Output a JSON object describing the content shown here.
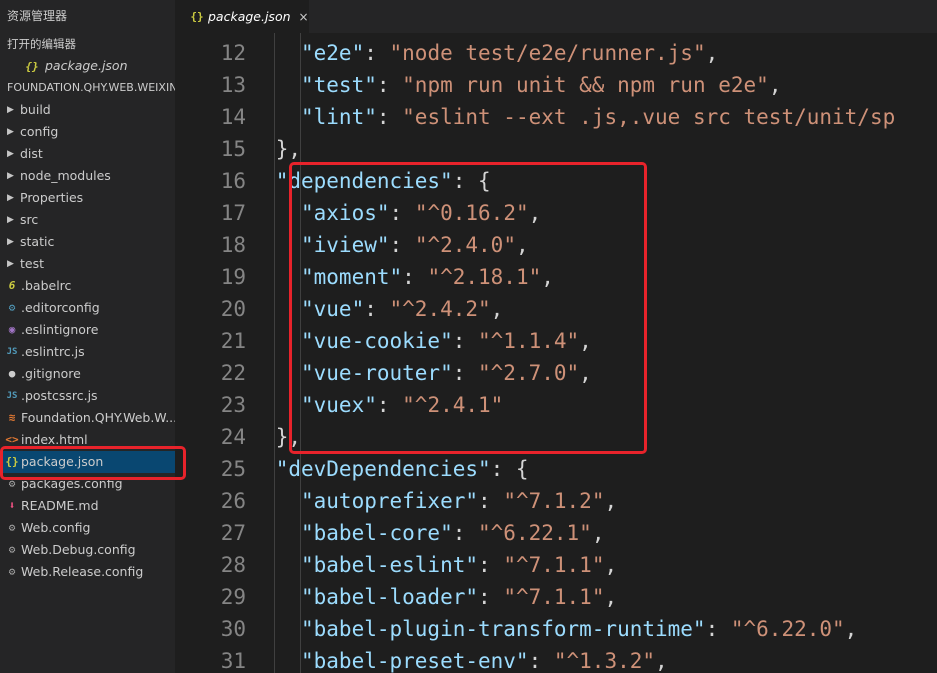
{
  "sidebar": {
    "title": "资源管理器",
    "open_editors_label": "打开的编辑器",
    "open_editors": [
      {
        "name": "package.json",
        "icon": "json-braces-icon"
      }
    ],
    "project_name": "FOUNDATION.QHY.WEB.WEIXIN...",
    "folders": [
      "build",
      "config",
      "dist",
      "node_modules",
      "Properties",
      "src",
      "static",
      "test"
    ],
    "files": [
      {
        "name": ".babelrc",
        "icon": "babel-icon",
        "glyph": "6"
      },
      {
        "name": ".editorconfig",
        "icon": "editorconfig-icon",
        "glyph": "⚙"
      },
      {
        "name": ".eslintignore",
        "icon": "eslint-icon",
        "glyph": "◉"
      },
      {
        "name": ".eslintrc.js",
        "icon": "js-file-icon",
        "glyph": "JS"
      },
      {
        "name": ".gitignore",
        "icon": "git-icon",
        "glyph": "●"
      },
      {
        "name": ".postcssrc.js",
        "icon": "js-file-icon",
        "glyph": "JS"
      },
      {
        "name": "Foundation.QHY.Web.W...",
        "icon": "rss-icon",
        "glyph": "≋"
      },
      {
        "name": "index.html",
        "icon": "html-icon",
        "glyph": "<>"
      },
      {
        "name": "package.json",
        "icon": "json-braces-icon",
        "glyph": "{}",
        "selected": true
      },
      {
        "name": "packages.config",
        "icon": "gear-icon",
        "glyph": "⚙"
      },
      {
        "name": "README.md",
        "icon": "readme-icon",
        "glyph": "⬇"
      },
      {
        "name": "Web.config",
        "icon": "gear-icon",
        "glyph": "⚙"
      },
      {
        "name": "Web.Debug.config",
        "icon": "gear-icon",
        "glyph": "⚙"
      },
      {
        "name": "Web.Release.config",
        "icon": "gear-icon",
        "glyph": "⚙"
      }
    ]
  },
  "tab": {
    "label": "package.json",
    "icon": "json-braces-icon",
    "close_glyph": "×"
  },
  "editor": {
    "lines": [
      {
        "n": "12",
        "indent": 2,
        "tokens": [
          [
            "k",
            "\"e2e\""
          ],
          [
            "p",
            ": "
          ],
          [
            "s",
            "\"node test/e2e/runner.js\""
          ],
          [
            "p",
            ","
          ]
        ]
      },
      {
        "n": "13",
        "indent": 2,
        "tokens": [
          [
            "k",
            "\"test\""
          ],
          [
            "p",
            ": "
          ],
          [
            "s",
            "\"npm run unit && npm run e2e\""
          ],
          [
            "p",
            ","
          ]
        ]
      },
      {
        "n": "14",
        "indent": 2,
        "tokens": [
          [
            "k",
            "\"lint\""
          ],
          [
            "p",
            ": "
          ],
          [
            "s",
            "\"eslint --ext .js,.vue src test/unit/sp"
          ]
        ]
      },
      {
        "n": "15",
        "indent": 1,
        "tokens": [
          [
            "p",
            "},"
          ]
        ]
      },
      {
        "n": "16",
        "indent": 1,
        "tokens": [
          [
            "k",
            "\"dependencies\""
          ],
          [
            "p",
            ": {"
          ]
        ]
      },
      {
        "n": "17",
        "indent": 2,
        "tokens": [
          [
            "k",
            "\"axios\""
          ],
          [
            "p",
            ": "
          ],
          [
            "s",
            "\"^0.16.2\""
          ],
          [
            "p",
            ","
          ]
        ]
      },
      {
        "n": "18",
        "indent": 2,
        "tokens": [
          [
            "k",
            "\"iview\""
          ],
          [
            "p",
            ": "
          ],
          [
            "s",
            "\"^2.4.0\""
          ],
          [
            "p",
            ","
          ]
        ]
      },
      {
        "n": "19",
        "indent": 2,
        "tokens": [
          [
            "k",
            "\"moment\""
          ],
          [
            "p",
            ": "
          ],
          [
            "s",
            "\"^2.18.1\""
          ],
          [
            "p",
            ","
          ]
        ]
      },
      {
        "n": "20",
        "indent": 2,
        "tokens": [
          [
            "k",
            "\"vue\""
          ],
          [
            "p",
            ": "
          ],
          [
            "s",
            "\"^2.4.2\""
          ],
          [
            "p",
            ","
          ]
        ]
      },
      {
        "n": "21",
        "indent": 2,
        "tokens": [
          [
            "k",
            "\"vue-cookie\""
          ],
          [
            "p",
            ": "
          ],
          [
            "s",
            "\"^1.1.4\""
          ],
          [
            "p",
            ","
          ]
        ]
      },
      {
        "n": "22",
        "indent": 2,
        "tokens": [
          [
            "k",
            "\"vue-router\""
          ],
          [
            "p",
            ": "
          ],
          [
            "s",
            "\"^2.7.0\""
          ],
          [
            "p",
            ","
          ]
        ]
      },
      {
        "n": "23",
        "indent": 2,
        "tokens": [
          [
            "k",
            "\"vuex\""
          ],
          [
            "p",
            ": "
          ],
          [
            "s",
            "\"^2.4.1\""
          ]
        ]
      },
      {
        "n": "24",
        "indent": 1,
        "tokens": [
          [
            "p",
            "},"
          ]
        ]
      },
      {
        "n": "25",
        "indent": 1,
        "tokens": [
          [
            "k",
            "\"devDependencies\""
          ],
          [
            "p",
            ": {"
          ]
        ]
      },
      {
        "n": "26",
        "indent": 2,
        "tokens": [
          [
            "k",
            "\"autoprefixer\""
          ],
          [
            "p",
            ": "
          ],
          [
            "s",
            "\"^7.1.2\""
          ],
          [
            "p",
            ","
          ]
        ]
      },
      {
        "n": "27",
        "indent": 2,
        "tokens": [
          [
            "k",
            "\"babel-core\""
          ],
          [
            "p",
            ": "
          ],
          [
            "s",
            "\"^6.22.1\""
          ],
          [
            "p",
            ","
          ]
        ]
      },
      {
        "n": "28",
        "indent": 2,
        "tokens": [
          [
            "k",
            "\"babel-eslint\""
          ],
          [
            "p",
            ": "
          ],
          [
            "s",
            "\"^7.1.1\""
          ],
          [
            "p",
            ","
          ]
        ]
      },
      {
        "n": "29",
        "indent": 2,
        "tokens": [
          [
            "k",
            "\"babel-loader\""
          ],
          [
            "p",
            ": "
          ],
          [
            "s",
            "\"^7.1.1\""
          ],
          [
            "p",
            ","
          ]
        ]
      },
      {
        "n": "30",
        "indent": 2,
        "tokens": [
          [
            "k",
            "\"babel-plugin-transform-runtime\""
          ],
          [
            "p",
            ": "
          ],
          [
            "s",
            "\"^6.22.0\""
          ],
          [
            "p",
            ","
          ]
        ]
      },
      {
        "n": "31",
        "indent": 2,
        "tokens": [
          [
            "k",
            "\"babel-preset-env\""
          ],
          [
            "p",
            ": "
          ],
          [
            "s",
            "\"^1.3.2\""
          ],
          [
            "p",
            ","
          ]
        ]
      }
    ]
  },
  "colors": {
    "highlight": "#e8232b",
    "selection": "#094771",
    "key": "#9cdcfe",
    "string": "#ce9178"
  }
}
